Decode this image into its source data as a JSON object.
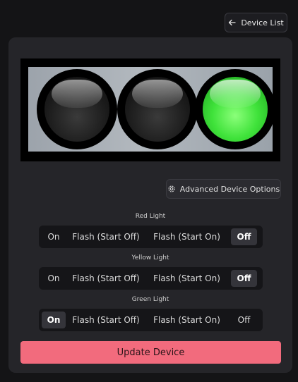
{
  "header": {
    "back_label": "Device List"
  },
  "traffic_light": {
    "lamps": [
      {
        "name": "red",
        "on": false
      },
      {
        "name": "yellow",
        "on": false
      },
      {
        "name": "green",
        "on": true
      }
    ]
  },
  "advanced_button_label": "Advanced Device Options",
  "groups": [
    {
      "label": "Red Light",
      "options": [
        "On",
        "Flash (Start Off)",
        "Flash (Start On)",
        "Off"
      ],
      "selected": "Off"
    },
    {
      "label": "Yellow Light",
      "options": [
        "On",
        "Flash (Start Off)",
        "Flash (Start On)",
        "Off"
      ],
      "selected": "Off"
    },
    {
      "label": "Green Light",
      "options": [
        "On",
        "Flash (Start Off)",
        "Flash (Start On)",
        "Off"
      ],
      "selected": "On"
    }
  ],
  "update_button_label": "Update Device",
  "colors": {
    "accent": "#f26b7d",
    "lamp_on_green": "#3fe23a",
    "card": "#252529",
    "background": "#141416"
  },
  "icons": {
    "back": "arrow-left-icon",
    "advanced": "gear-icon"
  }
}
